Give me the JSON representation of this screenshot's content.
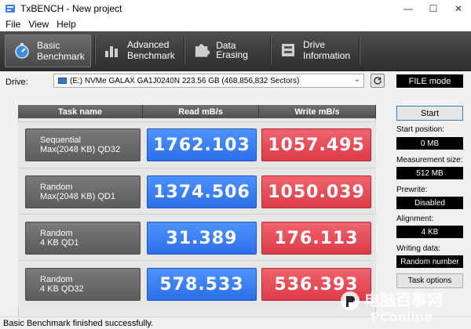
{
  "window": {
    "title": "TxBENCH - New project"
  },
  "menu": [
    "File",
    "View",
    "Help"
  ],
  "toolbar": {
    "tabs": [
      {
        "line1": "Basic",
        "line2": "Benchmark",
        "active": true
      },
      {
        "line1": "Advanced",
        "line2": "Benchmark",
        "active": false
      },
      {
        "line1": "Data Erasing",
        "line2": "",
        "active": false
      },
      {
        "line1": "Drive",
        "line2": "Information",
        "active": false
      }
    ]
  },
  "drive": {
    "label": "Drive:",
    "selected": "(E:) NVMe GALAX GA1J0240N  223.56 GB (468,856,832 Sectors)",
    "mode": "FILE mode"
  },
  "table": {
    "headers": [
      "Task name",
      "Read mB/s",
      "Write mB/s"
    ],
    "rows": [
      {
        "task_line1": "Sequential",
        "task_line2": "Max(2048 KB) QD32",
        "read": "1762.103",
        "write": "1057.495"
      },
      {
        "task_line1": "Random",
        "task_line2": "Max(2048 KB) QD1",
        "read": "1374.506",
        "write": "1050.039"
      },
      {
        "task_line1": "Random",
        "task_line2": "4 KB QD1",
        "read": "31.389",
        "write": "176.113"
      },
      {
        "task_line1": "Random",
        "task_line2": "4 KB QD32",
        "read": "578.533",
        "write": "536.393"
      }
    ]
  },
  "side": {
    "start_label": "Start",
    "start_position_label": "Start position:",
    "start_position_value": "0 MB",
    "measurement_size_label": "Measurement size:",
    "measurement_size_value": "512 MB",
    "prewrite_label": "Prewrite:",
    "prewrite_value": "Disabled",
    "alignment_label": "Alignment:",
    "alignment_value": "4 KB",
    "writing_data_label": "Writing data:",
    "writing_data_value": "Random number",
    "task_options_label": "Task options"
  },
  "status": {
    "text": "Basic Benchmark finished successfully."
  },
  "watermark": {
    "line1": "电脑百事网",
    "line2": "PConline"
  },
  "colors": {
    "read": "#3a7ff5",
    "write": "#e8505a",
    "toolbar": "#3c3c3c"
  }
}
